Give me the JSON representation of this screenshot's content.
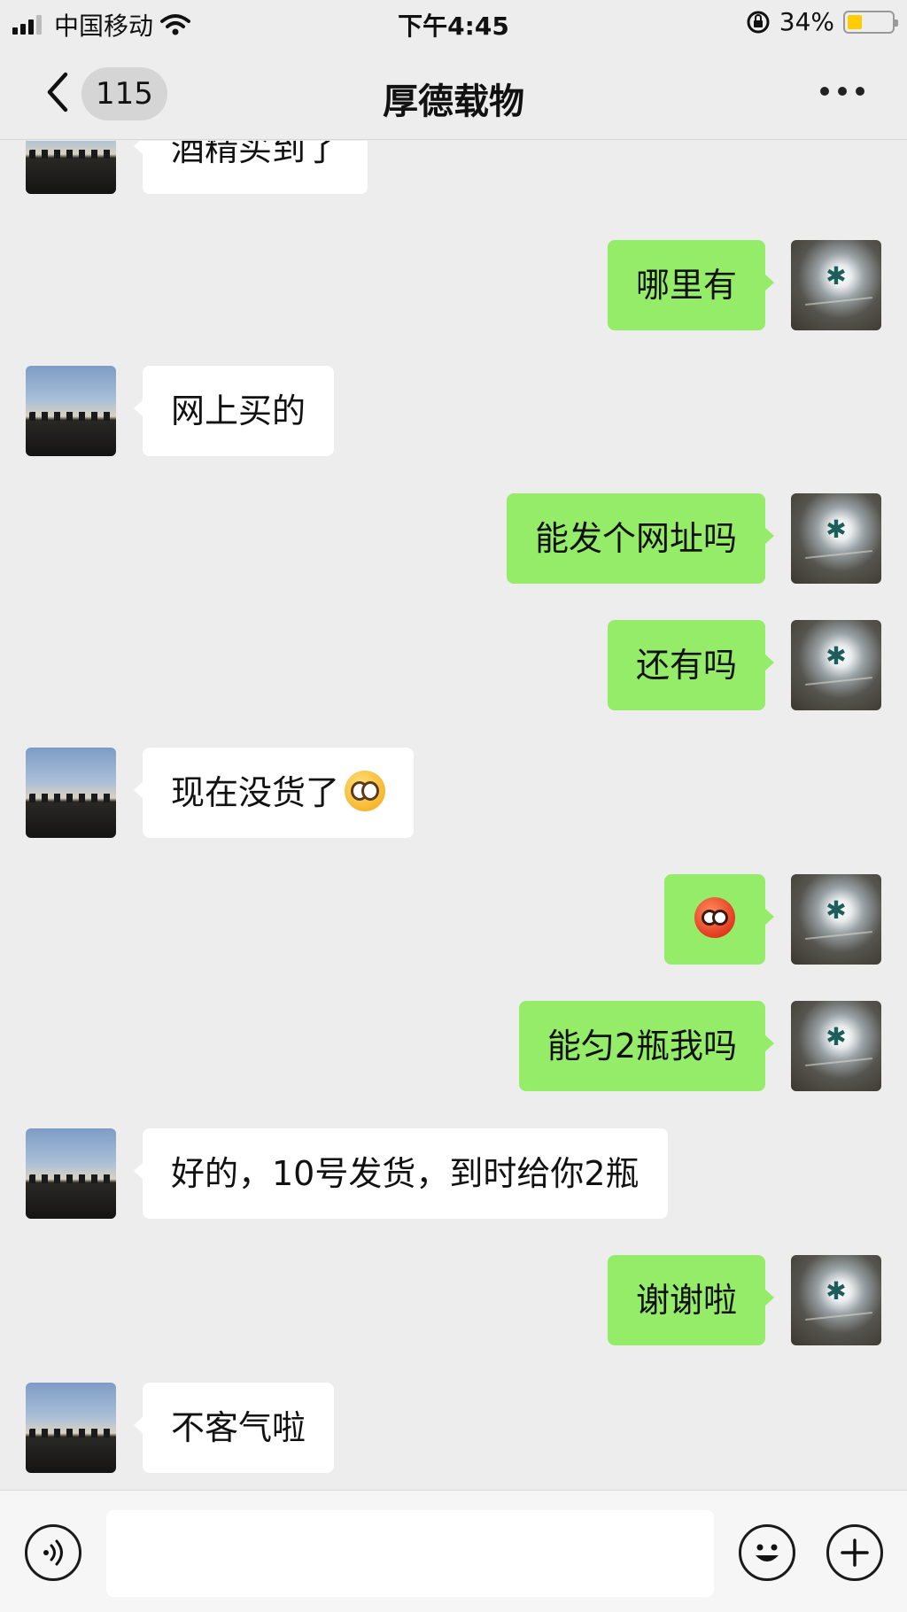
{
  "status_bar": {
    "carrier": "中国移动",
    "time": "下午4:45",
    "battery_percent": "34%",
    "battery_level": 0.34,
    "icons": [
      "signal-icon",
      "wifi-icon",
      "rotation-lock-icon",
      "battery-icon"
    ]
  },
  "nav": {
    "unread_count": "115",
    "title": "厚德载物",
    "back_icon": "chevron-left-icon",
    "more_icon": "more-dots-icon"
  },
  "messages": [
    {
      "side": "in",
      "text": "酒精买到了"
    },
    {
      "side": "out",
      "text": "哪里有"
    },
    {
      "side": "in",
      "text": "网上买的"
    },
    {
      "side": "out",
      "text": "能发个网址吗"
    },
    {
      "side": "out",
      "text": "还有吗"
    },
    {
      "side": "in",
      "text": "现在没货了",
      "emoji": "pleading-face-emoji"
    },
    {
      "side": "out",
      "text": "",
      "emoji": "hot-face-emoji"
    },
    {
      "side": "out",
      "text": "能匀2瓶我吗"
    },
    {
      "side": "in",
      "text": "好的，10号发货，到时给你2瓶"
    },
    {
      "side": "out",
      "text": "谢谢啦"
    },
    {
      "side": "in",
      "text": "不客气啦"
    }
  ],
  "input_bar": {
    "value": "",
    "icons": [
      "voice-icon",
      "emoji-icon",
      "plus-icon"
    ]
  },
  "colors": {
    "background": "#ededed",
    "outgoing_bubble": "#95ec69",
    "incoming_bubble": "#ffffff",
    "battery_fill": "#ffcc00"
  }
}
